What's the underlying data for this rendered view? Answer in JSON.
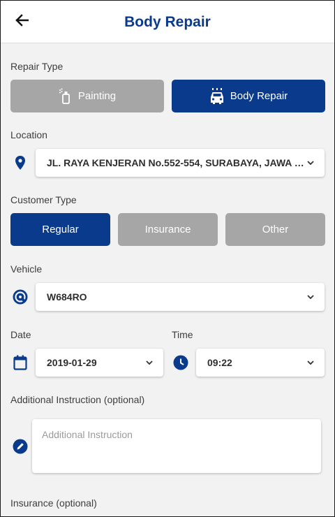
{
  "header": {
    "title": "Body Repair",
    "back_icon": "arrow-left-icon"
  },
  "repair_type": {
    "label": "Repair Type",
    "options": [
      {
        "label": "Painting",
        "icon": "spray-can-icon",
        "selected": false
      },
      {
        "label": "Body Repair",
        "icon": "car-wash-icon",
        "selected": true
      }
    ]
  },
  "location": {
    "label": "Location",
    "icon": "map-pin-icon",
    "value": "JL. RAYA KENJERAN No.552-554, SURABAYA, JAWA TI..."
  },
  "customer_type": {
    "label": "Customer Type",
    "options": [
      {
        "label": "Regular",
        "selected": true
      },
      {
        "label": "Insurance",
        "selected": false
      },
      {
        "label": "Other",
        "selected": false
      }
    ]
  },
  "vehicle": {
    "label": "Vehicle",
    "icon": "steering-wheel-icon",
    "value": "W684RO"
  },
  "date": {
    "label": "Date",
    "icon": "calendar-icon",
    "value": "2019-01-29"
  },
  "time": {
    "label": "Time",
    "icon": "clock-icon",
    "value": "09:22"
  },
  "instruction": {
    "label": "Additional Instruction (optional)",
    "icon": "pencil-icon",
    "placeholder": "Additional Instruction"
  },
  "insurance": {
    "label": "Insurance (optional)"
  },
  "colors": {
    "primary": "#0a3a8c",
    "inactive": "#a6a6a6",
    "background": "#f2f2f2"
  }
}
